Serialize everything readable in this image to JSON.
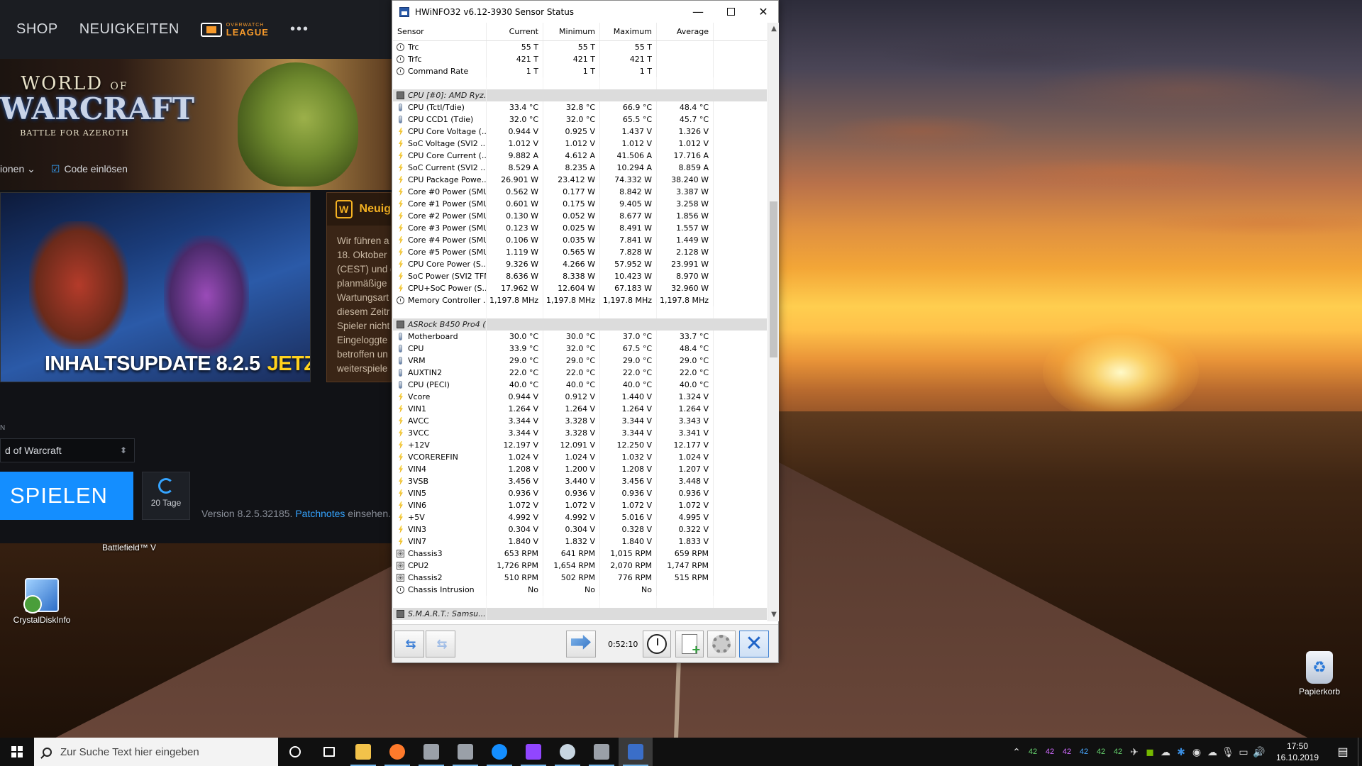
{
  "colors": {
    "battlenet_blue": "#148eff",
    "hwinfo_group_bg": "#dcdcdc",
    "taskbar_bg": "#101010",
    "news_gold": "#f5b222",
    "live_yellow": "#ffd21e"
  },
  "desktop": {
    "icons": [
      {
        "label": "CrystalDiskInfo",
        "icon": "crystaldiskinfo-icon"
      },
      {
        "label": "Papierkorb",
        "icon": "recycle-bin-icon"
      }
    ],
    "bnet_caption": "Battlefield™ V"
  },
  "battlenet": {
    "nav": {
      "shop": "SHOP",
      "news": "NEUIGKEITEN",
      "owl_line1": "OVERWATCH",
      "owl_line2": "LEAGUE",
      "more": "•••"
    },
    "hero": {
      "logo_world": "WORLD",
      "logo_of": "OF",
      "logo_warcraft": "WARCRAFT",
      "logo_sub": "BATTLE FOR AZEROTH",
      "link_options": "ionen ⌄",
      "link_code": "Code einlösen"
    },
    "banner": {
      "headline": "INHALTSUPDATE 8.2.5",
      "live": "JETZT LIVE"
    },
    "news_panel": {
      "title": "Neuig",
      "lines": [
        "Wir führen a",
        "18. Oktober",
        "(CEST) und d",
        "planmäßige",
        "Wartungsart",
        "diesem Zeitr",
        "Spieler nicht",
        "Eingeloggte",
        "betroffen un",
        "weiterspiele"
      ]
    },
    "game_label": "N",
    "game_select": "d of Warcraft",
    "play_button": "SPIELEN",
    "queue_days": "20 Tage",
    "version_text": "Version 8.2.5.32185.",
    "patch_link": "Patchnotes",
    "version_suffix": "einsehen."
  },
  "hwinfo": {
    "title": "HWiNFO32 v6.12-3930 Sensor Status",
    "columns": [
      "Sensor",
      "Current",
      "Minimum",
      "Maximum",
      "Average"
    ],
    "rows": [
      {
        "t": "clock",
        "n": "Trc",
        "c": "55 T",
        "mi": "55 T",
        "ma": "55 T",
        "a": ""
      },
      {
        "t": "clock",
        "n": "Trfc",
        "c": "421 T",
        "mi": "421 T",
        "ma": "421 T",
        "a": ""
      },
      {
        "t": "clock",
        "n": "Command Rate",
        "c": "1 T",
        "mi": "1 T",
        "ma": "1 T",
        "a": ""
      },
      {
        "t": "blank",
        "n": "",
        "c": "",
        "mi": "",
        "ma": "",
        "a": ""
      },
      {
        "t": "group",
        "n": "CPU [#0]: AMD Ryz...",
        "c": "",
        "mi": "",
        "ma": "",
        "a": ""
      },
      {
        "t": "temp",
        "n": "CPU (Tctl/Tdie)",
        "c": "33.4 °C",
        "mi": "32.8 °C",
        "ma": "66.9 °C",
        "a": "48.4 °C"
      },
      {
        "t": "temp",
        "n": "CPU CCD1 (Tdie)",
        "c": "32.0 °C",
        "mi": "32.0 °C",
        "ma": "65.5 °C",
        "a": "45.7 °C"
      },
      {
        "t": "volt",
        "n": "CPU Core Voltage (...",
        "c": "0.944 V",
        "mi": "0.925 V",
        "ma": "1.437 V",
        "a": "1.326 V"
      },
      {
        "t": "volt",
        "n": "SoC Voltage (SVI2 ...",
        "c": "1.012 V",
        "mi": "1.012 V",
        "ma": "1.012 V",
        "a": "1.012 V"
      },
      {
        "t": "volt",
        "n": "CPU Core Current (...",
        "c": "9.882 A",
        "mi": "4.612 A",
        "ma": "41.506 A",
        "a": "17.716 A"
      },
      {
        "t": "volt",
        "n": "SoC Current (SVI2 ...",
        "c": "8.529 A",
        "mi": "8.235 A",
        "ma": "10.294 A",
        "a": "8.859 A"
      },
      {
        "t": "volt",
        "n": "CPU Package Powe...",
        "c": "26.901 W",
        "mi": "23.412 W",
        "ma": "74.332 W",
        "a": "38.240 W"
      },
      {
        "t": "volt",
        "n": "Core #0 Power (SMU)",
        "c": "0.562 W",
        "mi": "0.177 W",
        "ma": "8.842 W",
        "a": "3.387 W"
      },
      {
        "t": "volt",
        "n": "Core #1 Power (SMU)",
        "c": "0.601 W",
        "mi": "0.175 W",
        "ma": "9.405 W",
        "a": "3.258 W"
      },
      {
        "t": "volt",
        "n": "Core #2 Power (SMU)",
        "c": "0.130 W",
        "mi": "0.052 W",
        "ma": "8.677 W",
        "a": "1.856 W"
      },
      {
        "t": "volt",
        "n": "Core #3 Power (SMU)",
        "c": "0.123 W",
        "mi": "0.025 W",
        "ma": "8.491 W",
        "a": "1.557 W"
      },
      {
        "t": "volt",
        "n": "Core #4 Power (SMU)",
        "c": "0.106 W",
        "mi": "0.035 W",
        "ma": "7.841 W",
        "a": "1.449 W"
      },
      {
        "t": "volt",
        "n": "Core #5 Power (SMU)",
        "c": "1.119 W",
        "mi": "0.565 W",
        "ma": "7.828 W",
        "a": "2.128 W"
      },
      {
        "t": "volt",
        "n": "CPU Core Power (S...",
        "c": "9.326 W",
        "mi": "4.266 W",
        "ma": "57.952 W",
        "a": "23.991 W"
      },
      {
        "t": "volt",
        "n": "SoC Power (SVI2 TFN)",
        "c": "8.636 W",
        "mi": "8.338 W",
        "ma": "10.423 W",
        "a": "8.970 W"
      },
      {
        "t": "volt",
        "n": "CPU+SoC Power (S...",
        "c": "17.962 W",
        "mi": "12.604 W",
        "ma": "67.183 W",
        "a": "32.960 W"
      },
      {
        "t": "clock",
        "n": "Memory Controller ...",
        "c": "1,197.8 MHz",
        "mi": "1,197.8 MHz",
        "ma": "1,197.8 MHz",
        "a": "1,197.8 MHz"
      },
      {
        "t": "blank",
        "n": "",
        "c": "",
        "mi": "",
        "ma": "",
        "a": ""
      },
      {
        "t": "group",
        "n": "ASRock B450 Pro4 (...",
        "c": "",
        "mi": "",
        "ma": "",
        "a": ""
      },
      {
        "t": "temp",
        "n": "Motherboard",
        "c": "30.0 °C",
        "mi": "30.0 °C",
        "ma": "37.0 °C",
        "a": "33.7 °C"
      },
      {
        "t": "temp",
        "n": "CPU",
        "c": "33.9 °C",
        "mi": "32.0 °C",
        "ma": "67.5 °C",
        "a": "48.4 °C"
      },
      {
        "t": "temp",
        "n": "VRM",
        "c": "29.0 °C",
        "mi": "29.0 °C",
        "ma": "29.0 °C",
        "a": "29.0 °C"
      },
      {
        "t": "temp",
        "n": "AUXTIN2",
        "c": "22.0 °C",
        "mi": "22.0 °C",
        "ma": "22.0 °C",
        "a": "22.0 °C"
      },
      {
        "t": "temp",
        "n": "CPU (PECI)",
        "c": "40.0 °C",
        "mi": "40.0 °C",
        "ma": "40.0 °C",
        "a": "40.0 °C"
      },
      {
        "t": "volt",
        "n": "Vcore",
        "c": "0.944 V",
        "mi": "0.912 V",
        "ma": "1.440 V",
        "a": "1.324 V"
      },
      {
        "t": "volt",
        "n": "VIN1",
        "c": "1.264 V",
        "mi": "1.264 V",
        "ma": "1.264 V",
        "a": "1.264 V"
      },
      {
        "t": "volt",
        "n": "AVCC",
        "c": "3.344 V",
        "mi": "3.328 V",
        "ma": "3.344 V",
        "a": "3.343 V"
      },
      {
        "t": "volt",
        "n": "3VCC",
        "c": "3.344 V",
        "mi": "3.328 V",
        "ma": "3.344 V",
        "a": "3.341 V"
      },
      {
        "t": "volt",
        "n": "+12V",
        "c": "12.197 V",
        "mi": "12.091 V",
        "ma": "12.250 V",
        "a": "12.177 V"
      },
      {
        "t": "volt",
        "n": "VCOREREFIN",
        "c": "1.024 V",
        "mi": "1.024 V",
        "ma": "1.032 V",
        "a": "1.024 V"
      },
      {
        "t": "volt",
        "n": "VIN4",
        "c": "1.208 V",
        "mi": "1.200 V",
        "ma": "1.208 V",
        "a": "1.207 V"
      },
      {
        "t": "volt",
        "n": "3VSB",
        "c": "3.456 V",
        "mi": "3.440 V",
        "ma": "3.456 V",
        "a": "3.448 V"
      },
      {
        "t": "volt",
        "n": "VIN5",
        "c": "0.936 V",
        "mi": "0.936 V",
        "ma": "0.936 V",
        "a": "0.936 V"
      },
      {
        "t": "volt",
        "n": "VIN6",
        "c": "1.072 V",
        "mi": "1.072 V",
        "ma": "1.072 V",
        "a": "1.072 V"
      },
      {
        "t": "volt",
        "n": "+5V",
        "c": "4.992 V",
        "mi": "4.992 V",
        "ma": "5.016 V",
        "a": "4.995 V"
      },
      {
        "t": "volt",
        "n": "VIN3",
        "c": "0.304 V",
        "mi": "0.304 V",
        "ma": "0.328 V",
        "a": "0.322 V"
      },
      {
        "t": "volt",
        "n": "VIN7",
        "c": "1.840 V",
        "mi": "1.832 V",
        "ma": "1.840 V",
        "a": "1.833 V"
      },
      {
        "t": "fan",
        "n": "Chassis3",
        "c": "653 RPM",
        "mi": "641 RPM",
        "ma": "1,015 RPM",
        "a": "659 RPM"
      },
      {
        "t": "fan",
        "n": "CPU2",
        "c": "1,726 RPM",
        "mi": "1,654 RPM",
        "ma": "2,070 RPM",
        "a": "1,747 RPM"
      },
      {
        "t": "fan",
        "n": "Chassis2",
        "c": "510 RPM",
        "mi": "502 RPM",
        "ma": "776 RPM",
        "a": "515 RPM"
      },
      {
        "t": "clock",
        "n": "Chassis Intrusion",
        "c": "No",
        "mi": "No",
        "ma": "No",
        "a": ""
      },
      {
        "t": "blank",
        "n": "",
        "c": "",
        "mi": "",
        "ma": "",
        "a": ""
      },
      {
        "t": "group",
        "n": "S.M.A.R.T.: Samsu...",
        "c": "",
        "mi": "",
        "ma": "",
        "a": ""
      }
    ],
    "elapsed": "0:52:10"
  },
  "taskbar": {
    "search_placeholder": "Zur Suche Text hier eingeben",
    "apps": [
      "cortana-icon",
      "task-view-icon",
      "file-explorer-icon",
      "firefox-icon",
      "app-icon",
      "app-icon",
      "battlenet-icon",
      "twitch-icon",
      "steam-icon",
      "app-icon",
      "hwinfo-icon"
    ],
    "tray_numbers": [
      "42",
      "42",
      "42",
      "42",
      "42",
      "42"
    ],
    "time": "17:50",
    "date": "16.10.2019"
  }
}
